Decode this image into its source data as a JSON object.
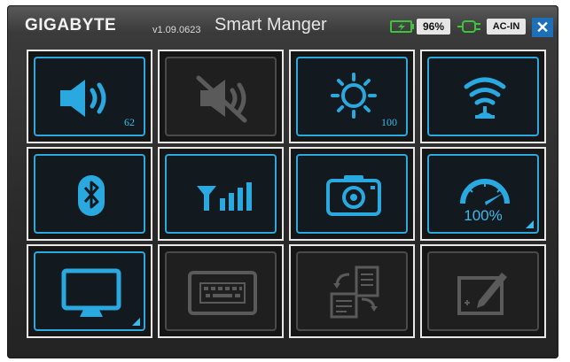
{
  "window": {
    "brand": "GIGABYTE",
    "version": "v1.09.0623",
    "app_name": "Smart Manger",
    "battery_percent": "96%",
    "power_source": "AC-IN",
    "close_label": "✕"
  },
  "tiles": {
    "volume": {
      "icon": "speaker-icon",
      "value": "62",
      "state": "on"
    },
    "mute": {
      "icon": "mute-icon",
      "state": "off"
    },
    "brightness": {
      "icon": "sun-icon",
      "value": "100",
      "state": "on"
    },
    "wifi": {
      "icon": "wifi-icon",
      "state": "on"
    },
    "bluetooth": {
      "icon": "bluetooth-icon",
      "state": "on"
    },
    "signal": {
      "icon": "signal-bars-icon",
      "state": "on"
    },
    "camera": {
      "icon": "camera-icon",
      "state": "on"
    },
    "fan": {
      "icon": "speedometer-icon",
      "value": "100%",
      "state": "on"
    },
    "display": {
      "icon": "monitor-icon",
      "state": "on"
    },
    "keyboard": {
      "icon": "keyboard-icon",
      "state": "off"
    },
    "switch_display": {
      "icon": "screen-swap-icon",
      "state": "off"
    },
    "touchpad": {
      "icon": "pen-tablet-icon",
      "state": "off"
    }
  },
  "colors": {
    "accent": "#2aa8e0",
    "inactive": "#5a5a5a",
    "title_bar": "#3a3a3a",
    "close": "#1d6fb8"
  }
}
